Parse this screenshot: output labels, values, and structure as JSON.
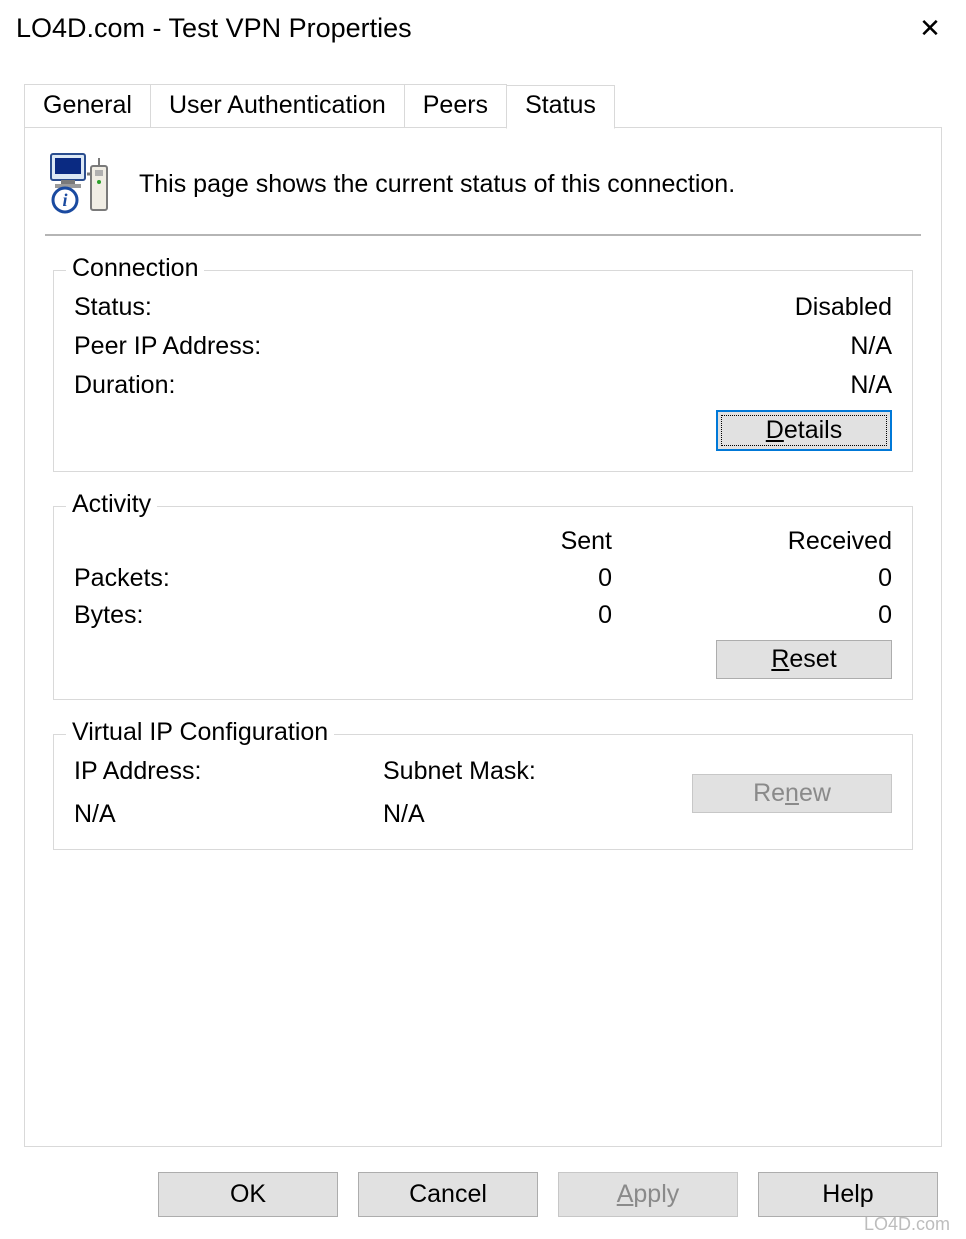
{
  "window": {
    "title": "LO4D.com  - Test VPN Properties"
  },
  "tabs": [
    {
      "label": "General"
    },
    {
      "label": "User Authentication"
    },
    {
      "label": "Peers"
    },
    {
      "label": "Status",
      "active": true
    }
  ],
  "intro": {
    "text": "This page shows the current status of this connection."
  },
  "connection": {
    "group_label": "Connection",
    "status_label": "Status:",
    "status_value": "Disabled",
    "peer_ip_label": "Peer IP Address:",
    "peer_ip_value": "N/A",
    "duration_label": "Duration:",
    "duration_value": "N/A",
    "details_button": "Details"
  },
  "activity": {
    "group_label": "Activity",
    "sent_header": "Sent",
    "received_header": "Received",
    "packets_label": "Packets:",
    "packets_sent": "0",
    "packets_received": "0",
    "bytes_label": "Bytes:",
    "bytes_sent": "0",
    "bytes_received": "0",
    "reset_button": "Reset"
  },
  "virtual_ip": {
    "group_label": "Virtual IP Configuration",
    "ip_label": "IP Address:",
    "ip_value": "N/A",
    "subnet_label": "Subnet Mask:",
    "subnet_value": "N/A",
    "renew_button": "Renew"
  },
  "actions": {
    "ok": "OK",
    "cancel": "Cancel",
    "apply": "Apply",
    "help": "Help"
  },
  "watermark": "LO4D.com"
}
